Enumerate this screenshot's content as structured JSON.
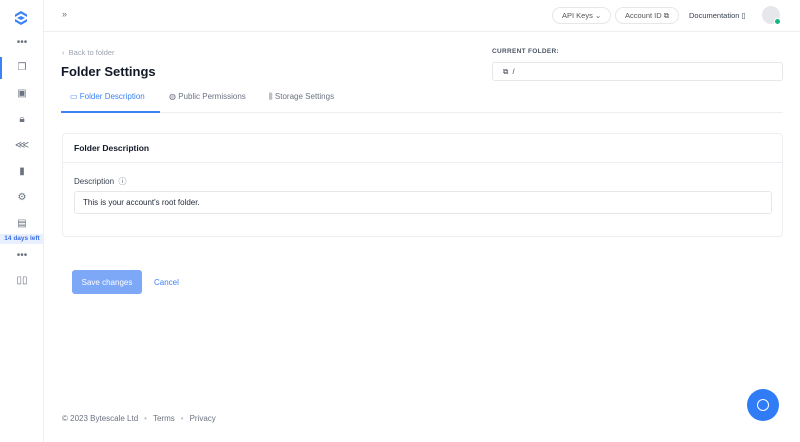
{
  "sidebar": {
    "trial": "14 days left",
    "items": [
      "more",
      "files",
      "media",
      "security",
      "integrations",
      "analytics",
      "settings",
      "billing",
      "more",
      "docs"
    ]
  },
  "topbar": {
    "api_keys": "API Keys",
    "account_id": "Account ID",
    "documentation": "Documentation"
  },
  "page": {
    "back": "Back to folder",
    "title": "Folder Settings",
    "current_folder_label": "CURRENT FOLDER:",
    "current_folder": "/"
  },
  "tabs": [
    {
      "label": "Folder Description"
    },
    {
      "label": "Public Permissions"
    },
    {
      "label": "Storage Settings"
    }
  ],
  "card": {
    "title": "Folder Description",
    "field_label": "Description",
    "value": "This is your account's root folder."
  },
  "actions": {
    "save": "Save changes",
    "cancel": "Cancel"
  },
  "footer": {
    "copyright": "© 2023 Bytescale Ltd",
    "terms": "Terms",
    "privacy": "Privacy"
  }
}
